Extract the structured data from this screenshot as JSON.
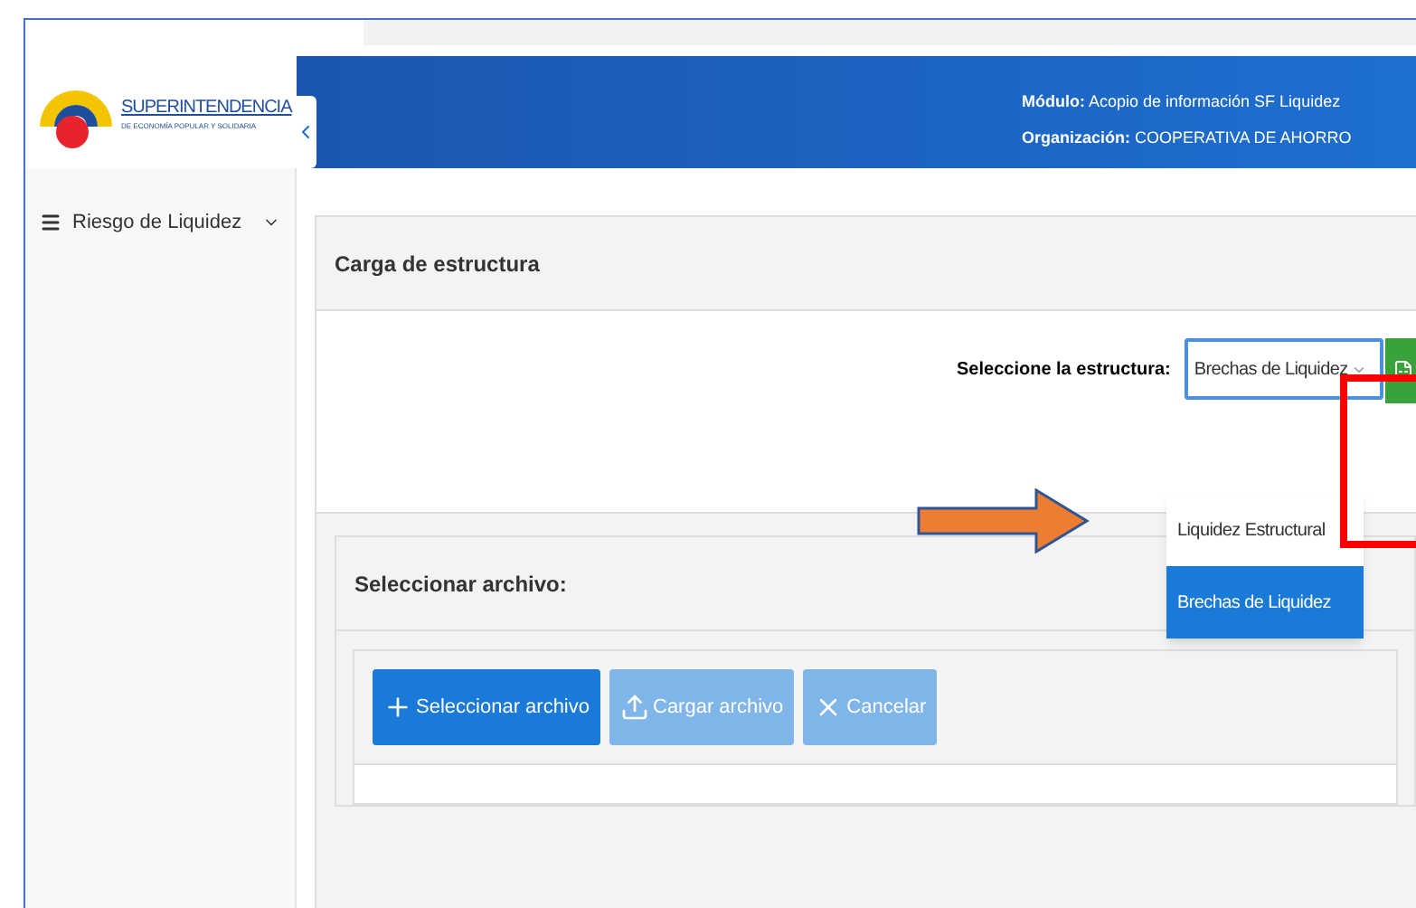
{
  "logo": {
    "title": "SUPERINTENDENCIA",
    "subtitle": "DE ECONOMÍA POPULAR Y SOLIDARIA"
  },
  "header": {
    "lines": [
      "**Módulo:** Acopio de información SF Liquidez",
      "**Organización:** COOPERATIVA DE AHORRO"
    ]
  },
  "sidebar": {
    "items": [
      {
        "label": "Riesgo de Liquidez"
      }
    ]
  },
  "panel": {
    "title": "Carga de estructura",
    "field_label": "Seleccione la estructura:",
    "select_value": "Brechas de Liquidez",
    "options": [
      {
        "label": "Liquidez Estructural",
        "selected": false
      },
      {
        "label": "Brechas de Liquidez",
        "selected": true
      }
    ]
  },
  "upload": {
    "title": "Seleccionar archivo:",
    "buttons": [
      {
        "label": "Seleccionar archivo",
        "kind": "add",
        "disabled": false
      },
      {
        "label": "Cargar archivo",
        "kind": "upload",
        "disabled": true
      },
      {
        "label": "Cancelar",
        "kind": "cancel",
        "disabled": true
      }
    ]
  }
}
